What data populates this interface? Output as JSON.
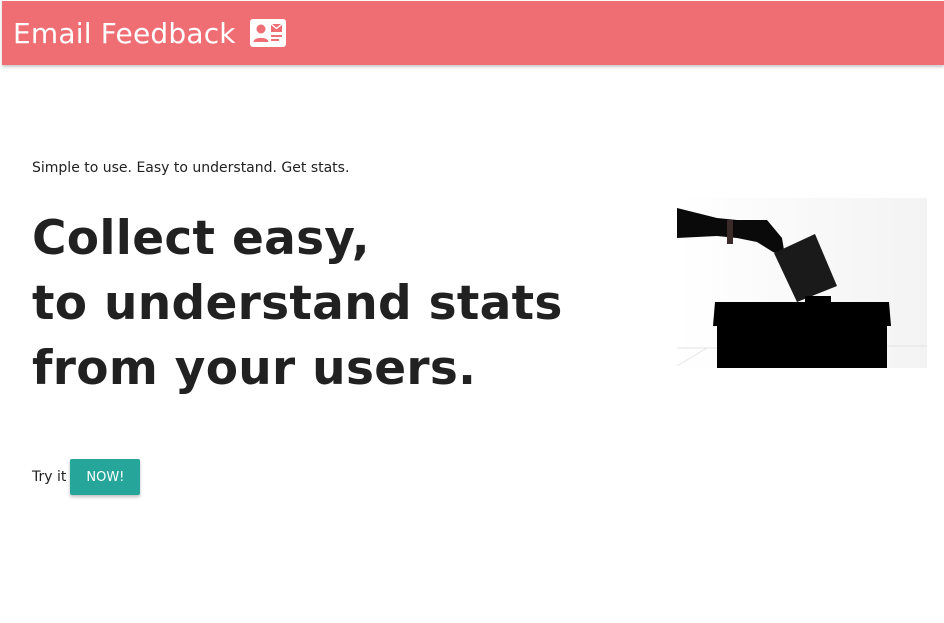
{
  "header": {
    "brand_label": "Email Feedback",
    "brand_icon": "contact-mail-icon",
    "brand_color": "#ef6e73"
  },
  "hero": {
    "tagline": "Simple to use. Easy to understand. Get stats.",
    "headline_lines": [
      "Collect easy,",
      "to understand stats",
      "from your users."
    ],
    "image": "ballot-box-image"
  },
  "cta": {
    "label": "Try it",
    "button_label": "NOW!",
    "button_color": "#26a69a"
  }
}
